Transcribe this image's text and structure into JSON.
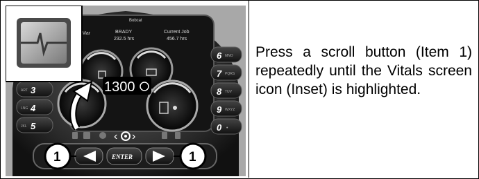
{
  "panel": {
    "brand": "Bobcat",
    "col_left": "Mar",
    "operator_name": "BRADY",
    "operator_hours": "232.5 hrs",
    "job_label": "Current Job",
    "job_hours": "456.7 hrs",
    "rpm_value": "1300",
    "enter_label": "ENTER",
    "left_keys": [
      {
        "label": "3",
        "tag": "ART"
      },
      {
        "label": "4",
        "tag": "LNG"
      },
      {
        "label": "5",
        "tag": "JKL"
      }
    ],
    "right_keys": [
      {
        "label": "6",
        "tag": "MNO"
      },
      {
        "label": "7",
        "tag": "PQRS"
      },
      {
        "label": "8",
        "tag": "TUV"
      },
      {
        "label": "9",
        "tag": "WXYZ"
      },
      {
        "label": "0",
        "tag": "•"
      }
    ]
  },
  "callouts": {
    "left": "1",
    "right": "1"
  },
  "instruction": "Press a scroll button (Item 1) repeatedly until the Vitals screen icon (Inset) is highlighted."
}
